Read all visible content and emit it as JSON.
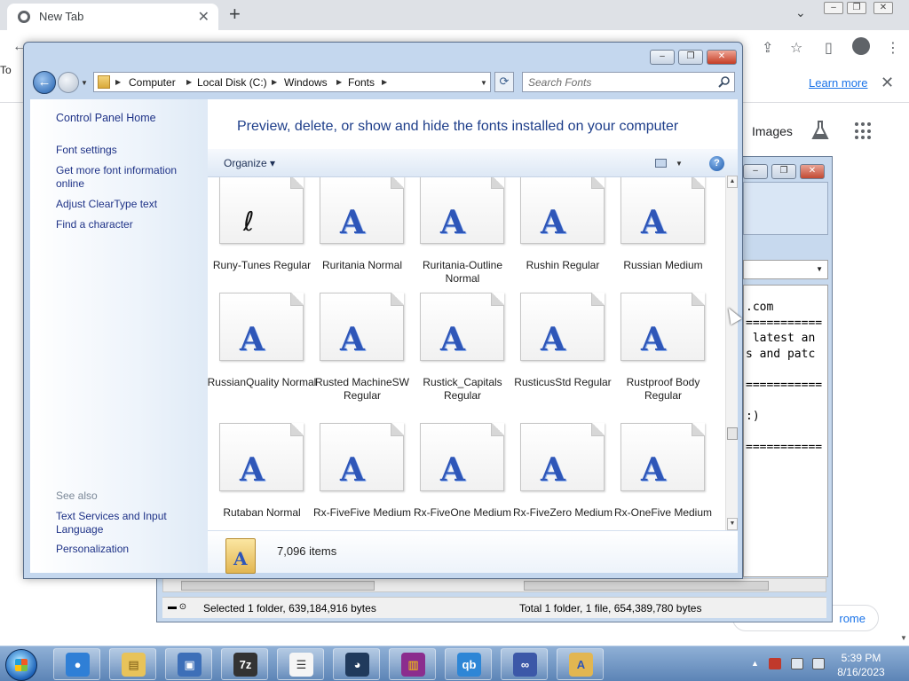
{
  "chrome": {
    "tab_title": "New Tab",
    "tab_close": "✕",
    "new_tab": "+",
    "tab_search": "⌄",
    "info_prefix": "To",
    "learn_more": "Learn more",
    "info_close": "✕",
    "images_link": "Images",
    "pill_text": "rome"
  },
  "bg_window": {
    "text_lines": [
      ".com",
      "===========",
      " latest an",
      "s and patc",
      "",
      "===========",
      "",
      ":)",
      "",
      "==========="
    ],
    "status_left": "Selected 1 folder, 639,184,916 bytes",
    "status_right": "Total 1 folder, 1 file, 654,389,780 bytes"
  },
  "explorer": {
    "breadcrumbs": [
      "Computer",
      "Local Disk (C:)",
      "Windows",
      "Fonts"
    ],
    "search_placeholder": "Search Fonts",
    "left_pane": {
      "home": "Control Panel Home",
      "links": [
        "Font settings",
        "Get more font information online",
        "Adjust ClearType text",
        "Find a character"
      ],
      "see_also_title": "See also",
      "see_also": [
        "Text Services and Input Language",
        "Personalization"
      ]
    },
    "heading": "Preview, delete, or show and hide the fonts installed on your computer",
    "organize": "Organize",
    "help": "?",
    "fonts": [
      {
        "name": "Runy-Tunes Regular",
        "glyph": "ℓ"
      },
      {
        "name": "Ruritania Normal",
        "glyph": "A"
      },
      {
        "name": "Ruritania-Outline Normal",
        "glyph": "A"
      },
      {
        "name": "Rushin Regular",
        "glyph": "A"
      },
      {
        "name": "Russian Medium",
        "glyph": "A"
      },
      {
        "name": "RussianQuality Normal",
        "glyph": "A"
      },
      {
        "name": "Rusted MachineSW Regular",
        "glyph": "A"
      },
      {
        "name": "Rustick_Capitals Regular",
        "glyph": "A"
      },
      {
        "name": "RusticusStd Regular",
        "glyph": "A"
      },
      {
        "name": "Rustproof Body Regular",
        "glyph": "A"
      },
      {
        "name": "Rutaban Normal",
        "glyph": "A"
      },
      {
        "name": "Rx-FiveFive Medium",
        "glyph": "A"
      },
      {
        "name": "Rx-FiveOne Medium",
        "glyph": "A"
      },
      {
        "name": "Rx-FiveZero Medium",
        "glyph": "A"
      },
      {
        "name": "Rx-OneFive Medium",
        "glyph": "A"
      }
    ],
    "item_count": "7,096 items"
  },
  "taskbar": {
    "apps": [
      "chrome",
      "explorer",
      "remote-desktop",
      "7-zip",
      "notepad",
      "cat-app",
      "winrar",
      "qbittorrent",
      "infinity",
      "fonts-folder"
    ],
    "time": "5:39 PM",
    "date": "8/16/2023"
  }
}
